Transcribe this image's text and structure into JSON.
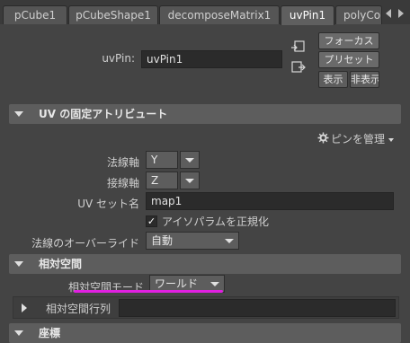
{
  "tabs": [
    {
      "label": "pCube1",
      "active": false
    },
    {
      "label": "pCubeShape1",
      "active": false
    },
    {
      "label": "decomposeMatrix1",
      "active": false
    },
    {
      "label": "uvPin1",
      "active": true
    },
    {
      "label": "polyCo",
      "active": false
    }
  ],
  "node": {
    "type_label": "uvPin:",
    "name": "uvPin1"
  },
  "buttons": {
    "focus": "フォーカス",
    "presets": "プリセット",
    "show": "表示",
    "hide": "非表示"
  },
  "sections": {
    "uv_fixed": {
      "title": "UV の固定アトリビュート",
      "pin_manage": "ピンを管理",
      "normal_axis": {
        "label": "法線軸",
        "value": "Y"
      },
      "tangent_axis": {
        "label": "接線軸",
        "value": "Z"
      },
      "uv_set": {
        "label": "UV セット名",
        "value": "map1"
      },
      "isoparm": {
        "label": "アイソパラムを正規化",
        "checked": true
      },
      "normal_override": {
        "label": "法線のオーバーライド",
        "value": "自動"
      }
    },
    "relative_space": {
      "title": "相対空間",
      "mode": {
        "label": "相対空間モード",
        "value": "ワールド"
      },
      "matrix": {
        "label": "相対空間行列",
        "value": ""
      }
    },
    "coordinates": {
      "title": "座標"
    }
  },
  "colors": {
    "highlight_underline": "#e020e0",
    "panel_bg": "#444444",
    "frame_header": "#5d5d5d",
    "field_bg": "#2b2b2b"
  }
}
